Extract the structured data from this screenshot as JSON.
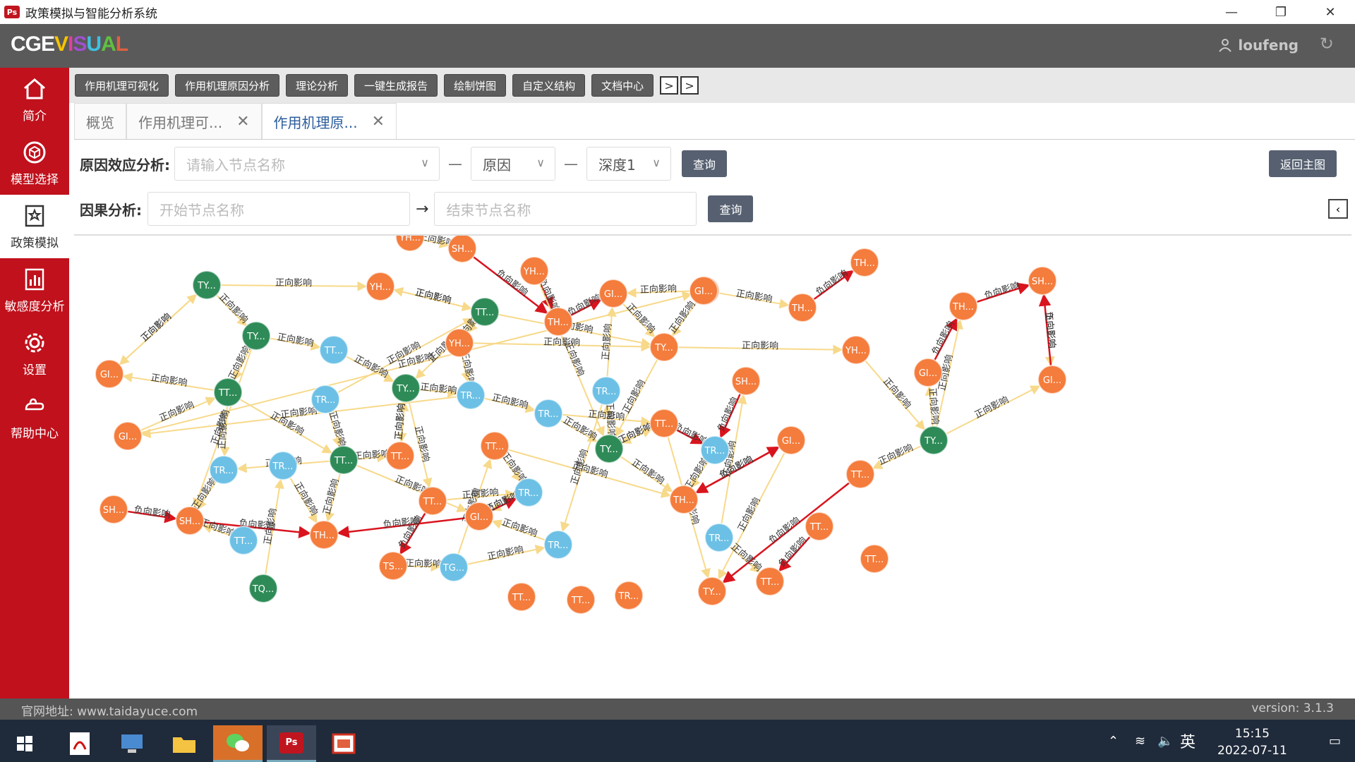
{
  "window": {
    "title": "政策模拟与智能分析系统",
    "app_icon": "Ps"
  },
  "header": {
    "logo": [
      {
        "ch": "C",
        "color": "#ffffff"
      },
      {
        "ch": "G",
        "color": "#ffffff"
      },
      {
        "ch": "E",
        "color": "#ffffff"
      },
      {
        "ch": "V",
        "color": "#f5c400"
      },
      {
        "ch": "I",
        "color": "#e040a0"
      },
      {
        "ch": "S",
        "color": "#a050d0"
      },
      {
        "ch": "U",
        "color": "#40c0e0"
      },
      {
        "ch": "A",
        "color": "#60c040"
      },
      {
        "ch": "L",
        "color": "#e06040"
      }
    ],
    "username": "loufeng"
  },
  "sidebar": {
    "items": [
      {
        "label": "简介",
        "icon": "home-icon"
      },
      {
        "label": "模型选择",
        "icon": "cube-icon"
      },
      {
        "label": "政策模拟",
        "icon": "star-doc-icon"
      },
      {
        "label": "敏感度分析",
        "icon": "chart-doc-icon"
      },
      {
        "label": "设置",
        "icon": "gear-icon"
      },
      {
        "label": "帮助中心",
        "icon": "hand-icon"
      }
    ]
  },
  "toolbar": {
    "buttons": [
      "作用机理可视化",
      "作用机理原因分析",
      "理论分析",
      "一键生成报告",
      "绘制饼图",
      "自定义结构",
      "文档中心"
    ],
    "nav": [
      ">",
      ">"
    ]
  },
  "tabs": [
    {
      "label": "概览",
      "closable": false,
      "active": false
    },
    {
      "label": "作用机理可...",
      "closable": true,
      "active": false
    },
    {
      "label": "作用机理原...",
      "closable": true,
      "active": true
    }
  ],
  "cause_effect": {
    "label": "原因效应分析:",
    "node_placeholder": "请输入节点名称",
    "direction": "原因",
    "depth": "深度1",
    "query": "查询",
    "back": "返回主图"
  },
  "causal": {
    "label": "因果分析:",
    "start_placeholder": "开始节点名称",
    "end_placeholder": "结束节点名称",
    "query": "查询"
  },
  "graph": {
    "colors": {
      "orange": "#f47c3c",
      "green": "#2e8b57",
      "blue": "#6cc0e5",
      "edge": "#f7d98a",
      "neg_edge": "#d9141e"
    },
    "nodes": [
      {
        "id": "n1",
        "label": "TY...",
        "color": "green"
      },
      {
        "id": "n2",
        "label": "TY...",
        "color": "green"
      },
      {
        "id": "n3",
        "label": "TT...",
        "color": "green"
      },
      {
        "id": "n4",
        "label": "TT...",
        "color": "green"
      },
      {
        "id": "n5",
        "label": "TY...",
        "color": "green"
      },
      {
        "id": "n6",
        "label": "TT...",
        "color": "green"
      },
      {
        "id": "n7",
        "label": "TY...",
        "color": "green"
      },
      {
        "id": "n8",
        "label": "TY...",
        "color": "green"
      },
      {
        "id": "n9",
        "label": "TQ...",
        "color": "green"
      },
      {
        "id": "n10",
        "label": "TT...",
        "color": "blue"
      },
      {
        "id": "n11",
        "label": "TR...",
        "color": "blue"
      },
      {
        "id": "n12",
        "label": "TR...",
        "color": "blue"
      },
      {
        "id": "n13",
        "label": "TR...",
        "color": "blue"
      },
      {
        "id": "n14",
        "label": "TR...",
        "color": "blue"
      },
      {
        "id": "n15",
        "label": "TR...",
        "color": "blue"
      },
      {
        "id": "n16",
        "label": "TR...",
        "color": "blue"
      },
      {
        "id": "n17",
        "label": "TT...",
        "color": "blue"
      },
      {
        "id": "n18",
        "label": "TR...",
        "color": "blue"
      },
      {
        "id": "n19",
        "label": "TR...",
        "color": "blue"
      },
      {
        "id": "n20",
        "label": "TR...",
        "color": "blue"
      },
      {
        "id": "n21",
        "label": "TG...",
        "color": "blue"
      },
      {
        "id": "n22",
        "label": "TR...",
        "color": "blue"
      },
      {
        "id": "n23",
        "label": "GI...",
        "color": "orange"
      },
      {
        "id": "n24",
        "label": "GI...",
        "color": "orange"
      },
      {
        "id": "n25",
        "label": "SH...",
        "color": "orange"
      },
      {
        "id": "n26",
        "label": "SH...",
        "color": "orange"
      },
      {
        "id": "n27",
        "label": "TH...",
        "color": "orange"
      },
      {
        "id": "n28",
        "label": "TS...",
        "color": "orange"
      },
      {
        "id": "n29",
        "label": "YH...",
        "color": "orange"
      },
      {
        "id": "n30",
        "label": "SH...",
        "color": "orange"
      },
      {
        "id": "n31",
        "label": "YH...",
        "color": "orange"
      },
      {
        "id": "n32",
        "label": "YH...",
        "color": "orange"
      },
      {
        "id": "n33",
        "label": "YH...",
        "color": "orange"
      },
      {
        "id": "n34",
        "label": "TH...",
        "color": "orange"
      },
      {
        "id": "n35",
        "label": "GI...",
        "color": "orange"
      },
      {
        "id": "n36",
        "label": "GI...",
        "color": "orange"
      },
      {
        "id": "n37",
        "label": "TY...",
        "color": "orange"
      },
      {
        "id": "n38",
        "label": "TT...",
        "color": "orange"
      },
      {
        "id": "n39",
        "label": "TT...",
        "color": "orange"
      },
      {
        "id": "n40",
        "label": "TT...",
        "color": "orange"
      },
      {
        "id": "n41",
        "label": "GI...",
        "color": "orange"
      },
      {
        "id": "n42",
        "label": "TT...",
        "color": "orange"
      },
      {
        "id": "n43",
        "label": "SH...",
        "color": "orange"
      },
      {
        "id": "n44",
        "label": "TH...",
        "color": "orange"
      },
      {
        "id": "n45",
        "label": "GI...",
        "color": "orange"
      },
      {
        "id": "n46",
        "label": "TH...",
        "color": "orange"
      },
      {
        "id": "n47",
        "label": "TT...",
        "color": "orange"
      },
      {
        "id": "n48",
        "label": "TT...",
        "color": "orange"
      },
      {
        "id": "n49",
        "label": "TY...",
        "color": "orange"
      },
      {
        "id": "n50",
        "label": "TT...",
        "color": "orange"
      },
      {
        "id": "n51",
        "label": "TH...",
        "color": "orange"
      },
      {
        "id": "n52",
        "label": "GI...",
        "color": "orange"
      },
      {
        "id": "n53",
        "label": "YH...",
        "color": "orange"
      },
      {
        "id": "n54",
        "label": "SH...",
        "color": "orange"
      },
      {
        "id": "n55",
        "label": "TH...",
        "color": "orange"
      },
      {
        "id": "n56",
        "label": "GI...",
        "color": "orange"
      },
      {
        "id": "n57",
        "label": "GI...",
        "color": "orange"
      },
      {
        "id": "n58",
        "label": "TT...",
        "color": "orange"
      },
      {
        "id": "n59",
        "label": "TT...",
        "color": "orange"
      },
      {
        "id": "n60",
        "label": "TR...",
        "color": "orange"
      },
      {
        "id": "n61",
        "label": "TT...",
        "color": "orange"
      },
      {
        "id": "n62",
        "label": "TR...",
        "color": "orange"
      },
      {
        "id": "n63",
        "label": "TT...",
        "color": "orange"
      }
    ],
    "edge_labels": [
      "正向影响",
      "负向影响"
    ]
  },
  "status": {
    "website": "官网地址: www.taidayuce.com",
    "version": "version: 3.1.3"
  },
  "taskbar": {
    "ime": "英",
    "time": "15:15",
    "date": "2022-07-11"
  }
}
